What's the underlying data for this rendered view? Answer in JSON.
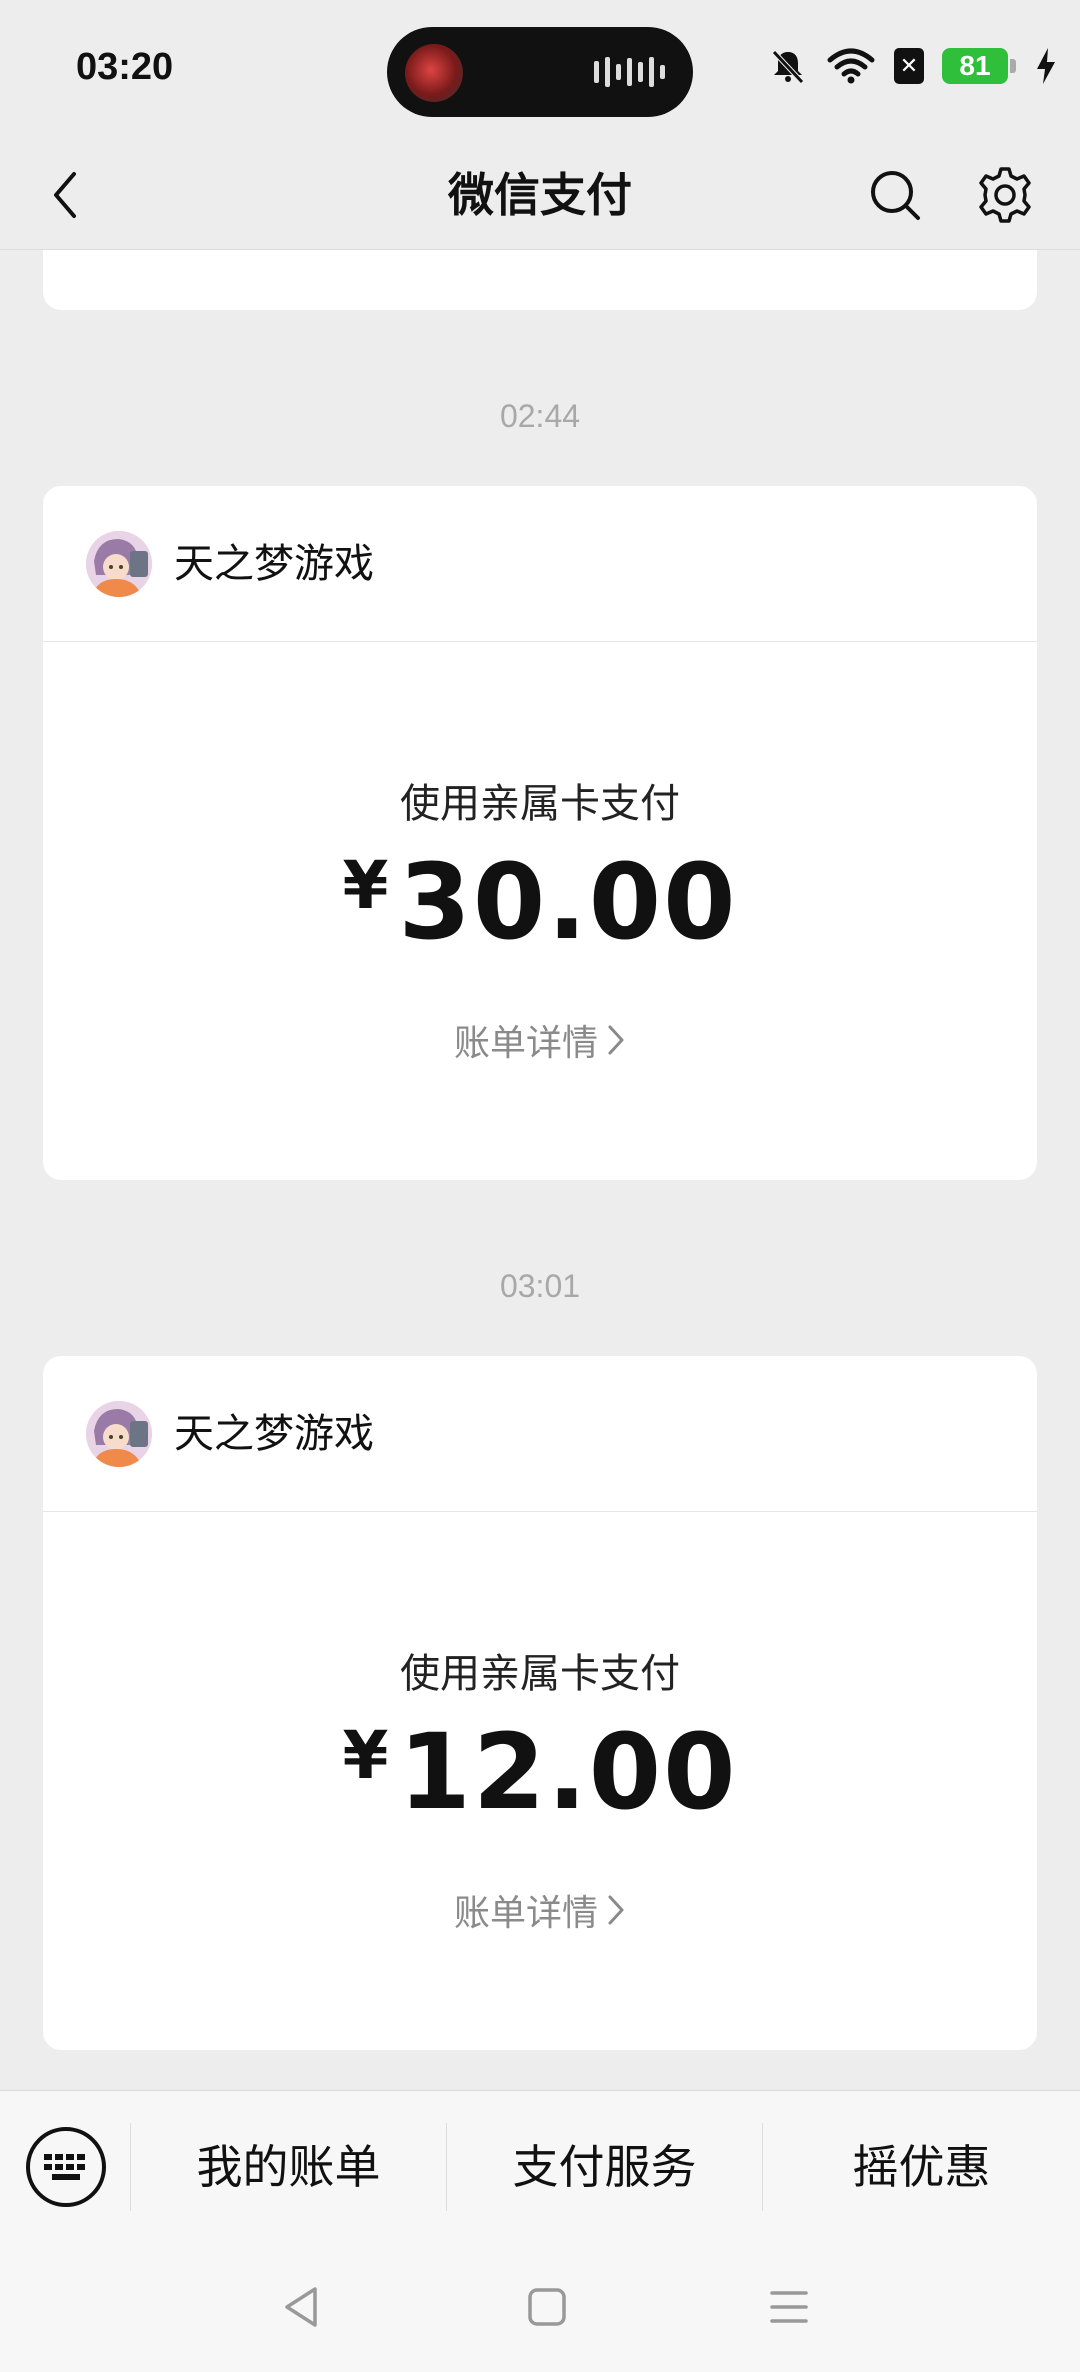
{
  "status_bar": {
    "time": "03:20",
    "battery_level": "81"
  },
  "nav": {
    "title": "微信支付"
  },
  "messages": [
    {
      "time": "02:44",
      "merchant": "天之梦游戏",
      "method": "使用亲属卡支付",
      "currency": "¥",
      "amount": "30.00",
      "detail_link": "账单详情"
    },
    {
      "time": "03:01",
      "merchant": "天之梦游戏",
      "method": "使用亲属卡支付",
      "currency": "¥",
      "amount": "12.00",
      "detail_link": "账单详情"
    }
  ],
  "bottom_menu": {
    "items": [
      "我的账单",
      "支付服务",
      "摇优惠"
    ]
  },
  "icons": {
    "back": "chevron-left-icon",
    "search": "search-icon",
    "settings": "gear-icon",
    "keyboard": "keyboard-icon"
  },
  "colors": {
    "background": "#ededed",
    "card": "#ffffff",
    "battery": "#2fbf3a"
  }
}
